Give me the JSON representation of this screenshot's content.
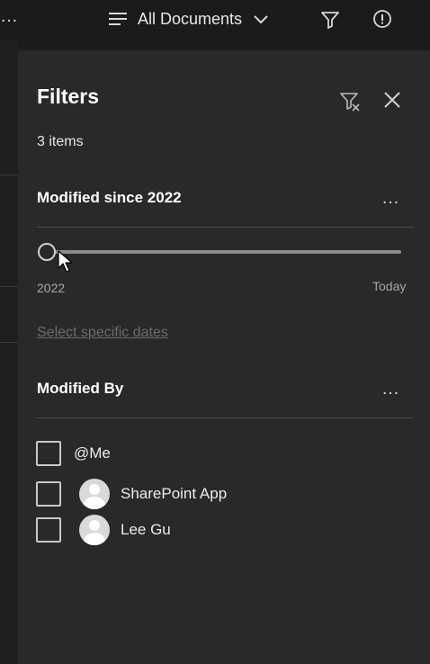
{
  "topbar": {
    "more_label": "…",
    "view_name": "All Documents"
  },
  "panel": {
    "title": "Filters",
    "item_count": "3 items"
  },
  "modified_section": {
    "title": "Modified since 2022",
    "more_label": "…",
    "slider": {
      "min_label": "2022",
      "max_label": "Today",
      "value": 0
    },
    "link_label": "Select specific dates"
  },
  "modified_by_section": {
    "title": "Modified By",
    "more_label": "…",
    "options": [
      {
        "label": "@Me",
        "checked": false,
        "has_avatar": false
      },
      {
        "label": "SharePoint App",
        "checked": false,
        "has_avatar": true
      },
      {
        "label": "Lee Gu",
        "checked": false,
        "has_avatar": true
      }
    ]
  },
  "colors": {
    "panel_bg": "#292929",
    "page_bg": "#1b1b1b",
    "text": "#ffffff",
    "muted_link": "#6b6b6b"
  }
}
